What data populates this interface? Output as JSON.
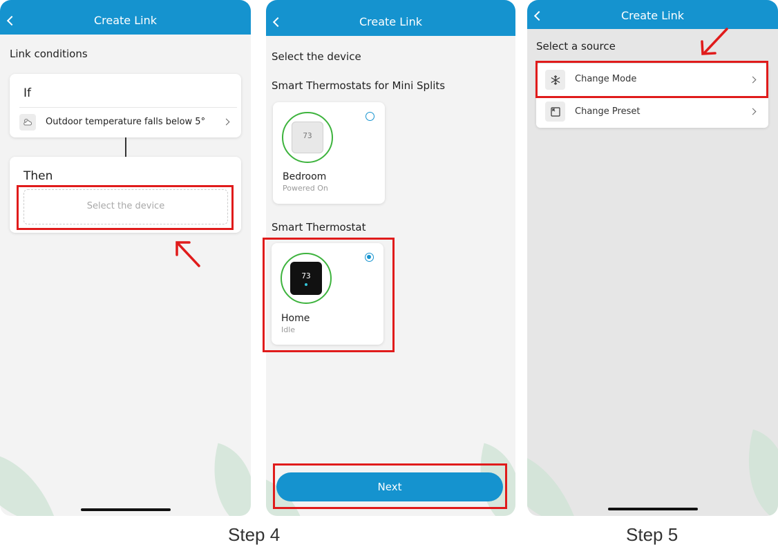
{
  "screens": [
    {
      "header": {
        "title": "Create Link"
      },
      "section_label": "Link conditions",
      "if_card": {
        "heading": "If",
        "condition_text": "Outdoor temperature falls below 5°"
      },
      "then_card": {
        "heading": "Then",
        "placeholder": "Select the device"
      }
    },
    {
      "header": {
        "title": "Create Link"
      },
      "section_label": "Select the device",
      "groups": [
        {
          "title": "Smart Thermostats for Mini Splits",
          "device": {
            "name": "Bedroom",
            "status": "Powered On",
            "display": "73",
            "selected": false
          }
        },
        {
          "title": "Smart Thermostat",
          "device": {
            "name": "Home",
            "status": "Idle",
            "display": "73",
            "selected": true
          }
        }
      ],
      "next_button": "Next"
    },
    {
      "header": {
        "title": "Create Link"
      },
      "section_label": "Select a source",
      "options": [
        {
          "label": "Change Mode",
          "icon": "snowflake-icon"
        },
        {
          "label": "Change Preset",
          "icon": "preset-icon"
        }
      ]
    }
  ],
  "step_labels": [
    "Step 4",
    "Step 5"
  ],
  "colors": {
    "header": "#1593cf",
    "highlight": "#e01b1b",
    "ring": "#3db33d",
    "button": "#1593cf"
  }
}
